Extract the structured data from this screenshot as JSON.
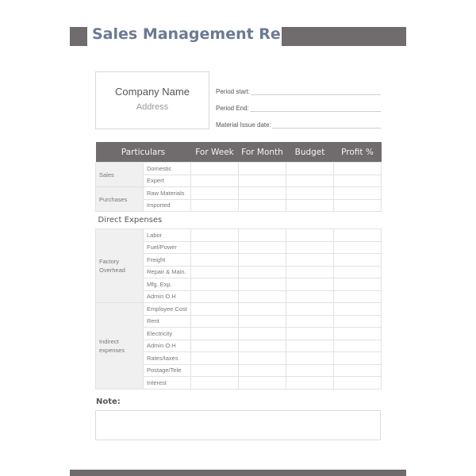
{
  "header": {
    "title": "Sales Management Report"
  },
  "company": {
    "name": "Company Name",
    "address": "Address"
  },
  "fields": [
    {
      "label": "Period start:",
      "value": ""
    },
    {
      "label": "Period End:",
      "value": ""
    },
    {
      "label": "Material Issue date:",
      "value": ""
    }
  ],
  "table": {
    "columns": [
      "Particulars",
      "For Week",
      "For Month",
      "Budget",
      "Profit %"
    ],
    "groups": [
      {
        "label": "Sales",
        "items": [
          "Domestic",
          "Expert"
        ]
      },
      {
        "label": "Purchases",
        "items": [
          "Raw Materials",
          "Imported"
        ]
      }
    ],
    "section": "Direct Expenses",
    "groups2": [
      {
        "label": "Factory Overhead",
        "items": [
          "Labor",
          "Fuel/Power",
          "Freight",
          "Repair & Main.",
          "Mfg. Exp.",
          "Admin O.H"
        ]
      },
      {
        "label": "Indirect expenses",
        "items": [
          "Employee Cost",
          "Rent",
          "Electricity",
          "Admin O.H",
          "Rates/taxes",
          "Postage/Tele",
          "Interest"
        ]
      }
    ]
  },
  "note": {
    "label": "Note:",
    "value": ""
  },
  "colors": {
    "header_bar": "#706b6c",
    "title": "#6b7a93",
    "group_bg": "#f0f0f0"
  }
}
